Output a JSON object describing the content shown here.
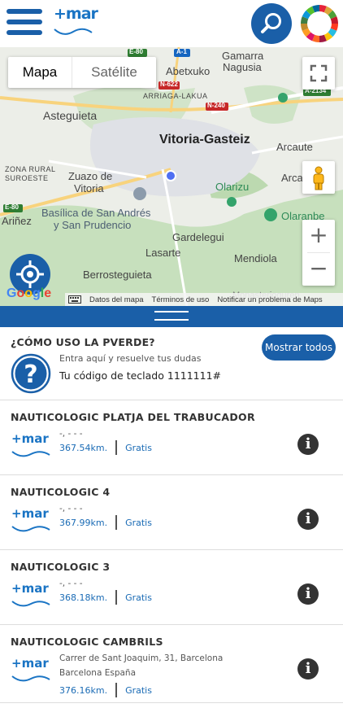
{
  "header": {
    "menu_icon": "hamburger-icon",
    "logo_text": "+mar",
    "search_icon": "search-icon",
    "sdg_icon": "sdg-wheel-icon",
    "brand_color": "#1a5fa8"
  },
  "map": {
    "map_type_map": "Mapa",
    "map_type_satellite": "Satélite",
    "labels": {
      "abetxuko": "Abetxuko",
      "gamarra": "Gamarra",
      "nagusia": "Nagusia",
      "arriaga": "ARRIAGA-LAKUA",
      "asteguieta": "Asteguieta",
      "vitoria": "Vitoria-Gasteiz",
      "arcaute": "Arcaute",
      "zona_rural": "ZONA RURAL",
      "suroeste": "SUROESTE",
      "zuazo1": "Zuazo de",
      "zuazo2": "Vitoria",
      "olarizu": "Olarizu",
      "arca": "Arca",
      "arinez": "Ariñez",
      "basilica1": "Basílica de San Andrés",
      "basilica2": "y San Prudencio",
      "olarambe": "Olaranbe",
      "gardelegui": "Gardelegui",
      "lasarte": "Lasarte",
      "mendiola": "Mendiola",
      "berrosteguieta": "Berrosteguieta",
      "monasterioguren": "Monasterioguren"
    },
    "road_badges": {
      "e80_top": "E-80",
      "a1": "A-1",
      "n622": "N-622",
      "n240": "N-240",
      "a2134": "A-2134",
      "e80_left": "E-80"
    },
    "google_logo": "Google",
    "attribution": {
      "data": "Datos del mapa",
      "terms": "Términos de uso",
      "report": "Notificar un problema de Maps"
    },
    "fullscreen_icon": "fullscreen-icon",
    "pegman_icon": "pegman-icon",
    "zoom_in": "+",
    "zoom_out": "−",
    "locate_icon": "crosshair-icon"
  },
  "help": {
    "title": "¿CÓMO USO LA PVERDE?",
    "subtitle": "Entra aquí y resuelve tus dudas",
    "code_line": "Tu código de teclado 1111111#",
    "show_all": "Mostrar todos",
    "help_icon": "question-icon"
  },
  "items": [
    {
      "name": "NAUTICOLOGIC PLATJA DEL TRABUCADOR",
      "address1": "-, - - -",
      "address2": "",
      "distance": "367.54km.",
      "price": "Gratis",
      "logo": "+mar"
    },
    {
      "name": "NAUTICOLOGIC 4",
      "address1": "-, - - -",
      "address2": "",
      "distance": "367.99km.",
      "price": "Gratis",
      "logo": "+mar"
    },
    {
      "name": "NAUTICOLOGIC 3",
      "address1": "-, - - -",
      "address2": "",
      "distance": "368.18km.",
      "price": "Gratis",
      "logo": "+mar"
    },
    {
      "name": "NAUTICOLOGIC CAMBRILS",
      "address1": "Carrer de Sant Joaquim, 31, Barcelona",
      "address2": "Barcelona España",
      "distance": "376.16km.",
      "price": "Gratis",
      "logo": "+mar"
    }
  ],
  "info_icon": "info-icon"
}
